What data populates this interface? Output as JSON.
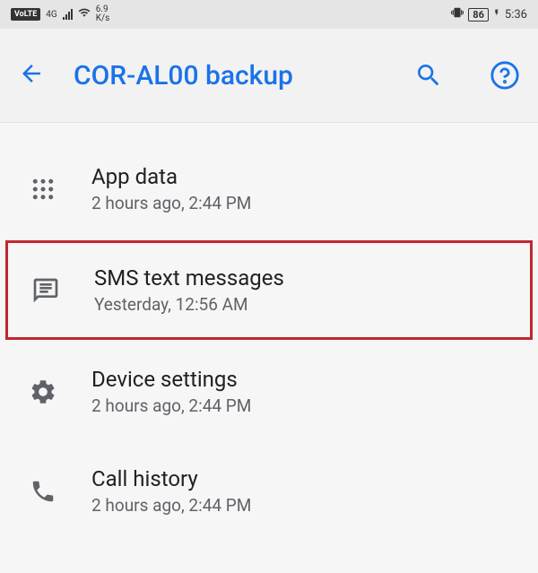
{
  "status_bar": {
    "volte": "VoLTE",
    "network": "4G",
    "data_rate_top": "6.9",
    "data_rate_bottom": "K/s",
    "battery": "86",
    "time": "5:36"
  },
  "header": {
    "title": "COR-AL00 backup"
  },
  "items": [
    {
      "title": "App data",
      "subtitle": "2 hours ago, 2:44 PM"
    },
    {
      "title": "SMS text messages",
      "subtitle": "Yesterday, 12:56 AM"
    },
    {
      "title": "Device settings",
      "subtitle": "2 hours ago, 2:44 PM"
    },
    {
      "title": "Call history",
      "subtitle": "2 hours ago, 2:44 PM"
    }
  ]
}
